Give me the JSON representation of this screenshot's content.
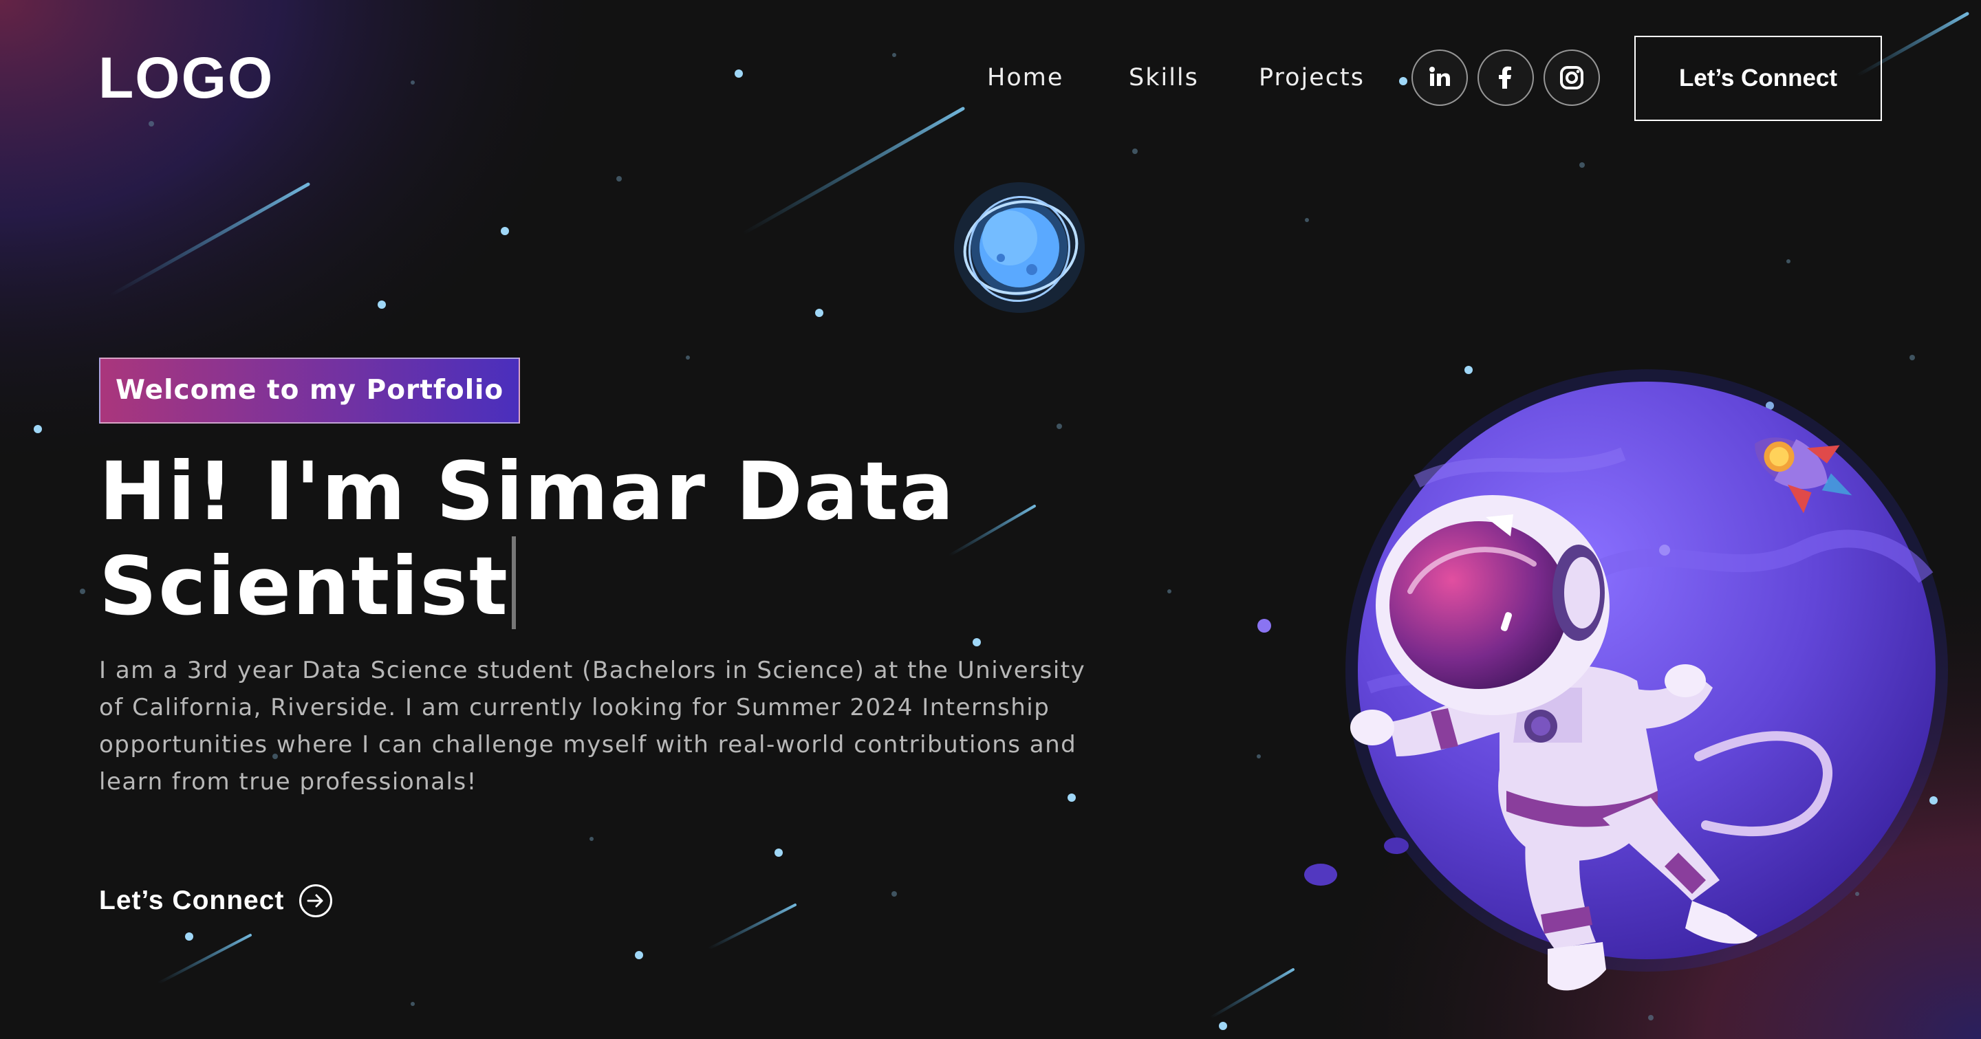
{
  "nav": {
    "logo": "LOGO",
    "links": [
      "Home",
      "Skills",
      "Projects"
    ],
    "social": [
      {
        "name": "linkedin",
        "glyph": "in"
      },
      {
        "name": "facebook",
        "glyph": "f"
      },
      {
        "name": "instagram",
        "glyph": ""
      }
    ],
    "connect_label": "Let’s Connect"
  },
  "hero": {
    "tagline": "Welcome to my Portfolio",
    "headline_line1": "Hi! I'm Simar Data",
    "headline_line2": "Scientist",
    "description": "I am a 3rd year Data Science student (Bachelors in Science) at the University of California, Riverside. I am currently looking for Summer 2024 Internship opportunities where I can challenge myself with real-world contributions and learn from true professionals!",
    "cta_label": "Let’s Connect"
  },
  "icons": {
    "cta": "arrow-right-circle-icon",
    "planet": "purple-planet",
    "astronaut": "astronaut-illustration",
    "rocket": "rocket-illustration",
    "moon": "blue-moon"
  },
  "colors": {
    "background": "#121212",
    "tag_gradient_start": "#aa367c",
    "tag_gradient_end": "#4a2fbd",
    "planet": "#6a4fe0",
    "glow_pink": "#b0306f"
  }
}
